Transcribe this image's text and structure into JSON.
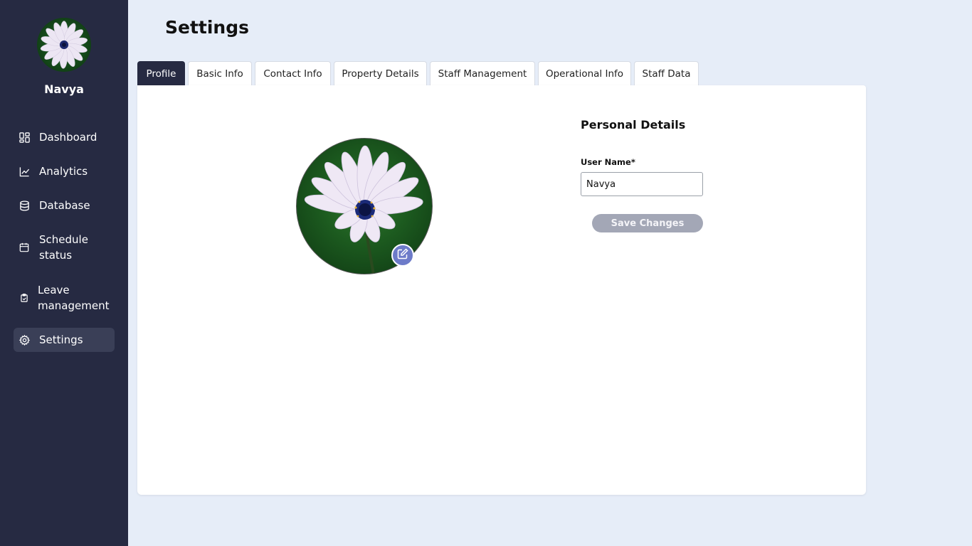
{
  "user": {
    "name": "Navya"
  },
  "sidebar": {
    "items": [
      {
        "label": "Dashboard",
        "icon": "dashboard-icon"
      },
      {
        "label": "Analytics",
        "icon": "chart-line-icon"
      },
      {
        "label": "Database",
        "icon": "database-icon"
      },
      {
        "label": "Schedule status",
        "icon": "calendar-icon"
      },
      {
        "label": "Leave management",
        "icon": "clipboard-icon"
      },
      {
        "label": "Settings",
        "icon": "gear-icon",
        "active": true
      }
    ]
  },
  "page": {
    "title": "Settings"
  },
  "tabs": [
    {
      "label": "Profile",
      "active": true
    },
    {
      "label": "Basic Info"
    },
    {
      "label": "Contact Info"
    },
    {
      "label": "Property Details"
    },
    {
      "label": "Staff Management"
    },
    {
      "label": "Operational Info"
    },
    {
      "label": "Staff Data"
    }
  ],
  "profile": {
    "section_title": "Personal Details",
    "username_label": "User Name*",
    "username_value": "Navya",
    "save_label": "Save Changes",
    "edit_icon": "pencil-edit-icon"
  },
  "colors": {
    "sidebar_bg": "#262a42",
    "page_bg": "#e6edf8",
    "active_tab": "#262a42",
    "edit_button": "#6d7bc9",
    "save_button": "#a3a7b6"
  }
}
